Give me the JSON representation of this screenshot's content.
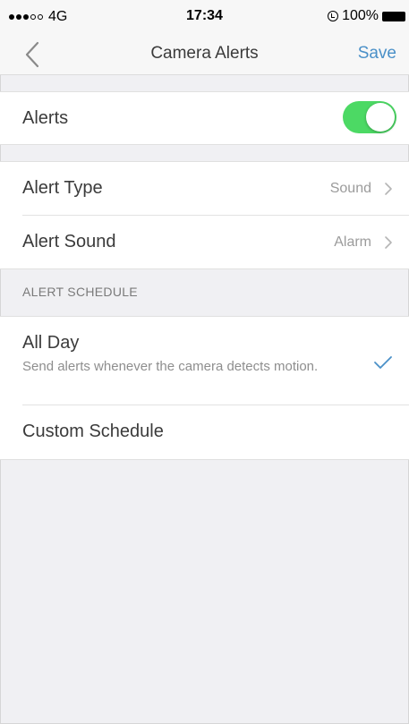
{
  "status": {
    "carrier": "4G",
    "time": "17:34",
    "battery": "100%"
  },
  "nav": {
    "title": "Camera Alerts",
    "save_label": "Save"
  },
  "alerts": {
    "label": "Alerts",
    "enabled": true
  },
  "alert_type": {
    "label": "Alert Type",
    "value": "Sound"
  },
  "alert_sound": {
    "label": "Alert Sound",
    "value": "Alarm"
  },
  "schedule": {
    "header": "ALERT SCHEDULE",
    "all_day": {
      "title": "All Day",
      "description": "Send alerts whenever the camera detects motion.",
      "selected": true
    },
    "custom": {
      "label": "Custom Schedule"
    }
  },
  "colors": {
    "accent": "#4a90c8",
    "toggle_on": "#4cd964",
    "background": "#f0f0f3"
  }
}
